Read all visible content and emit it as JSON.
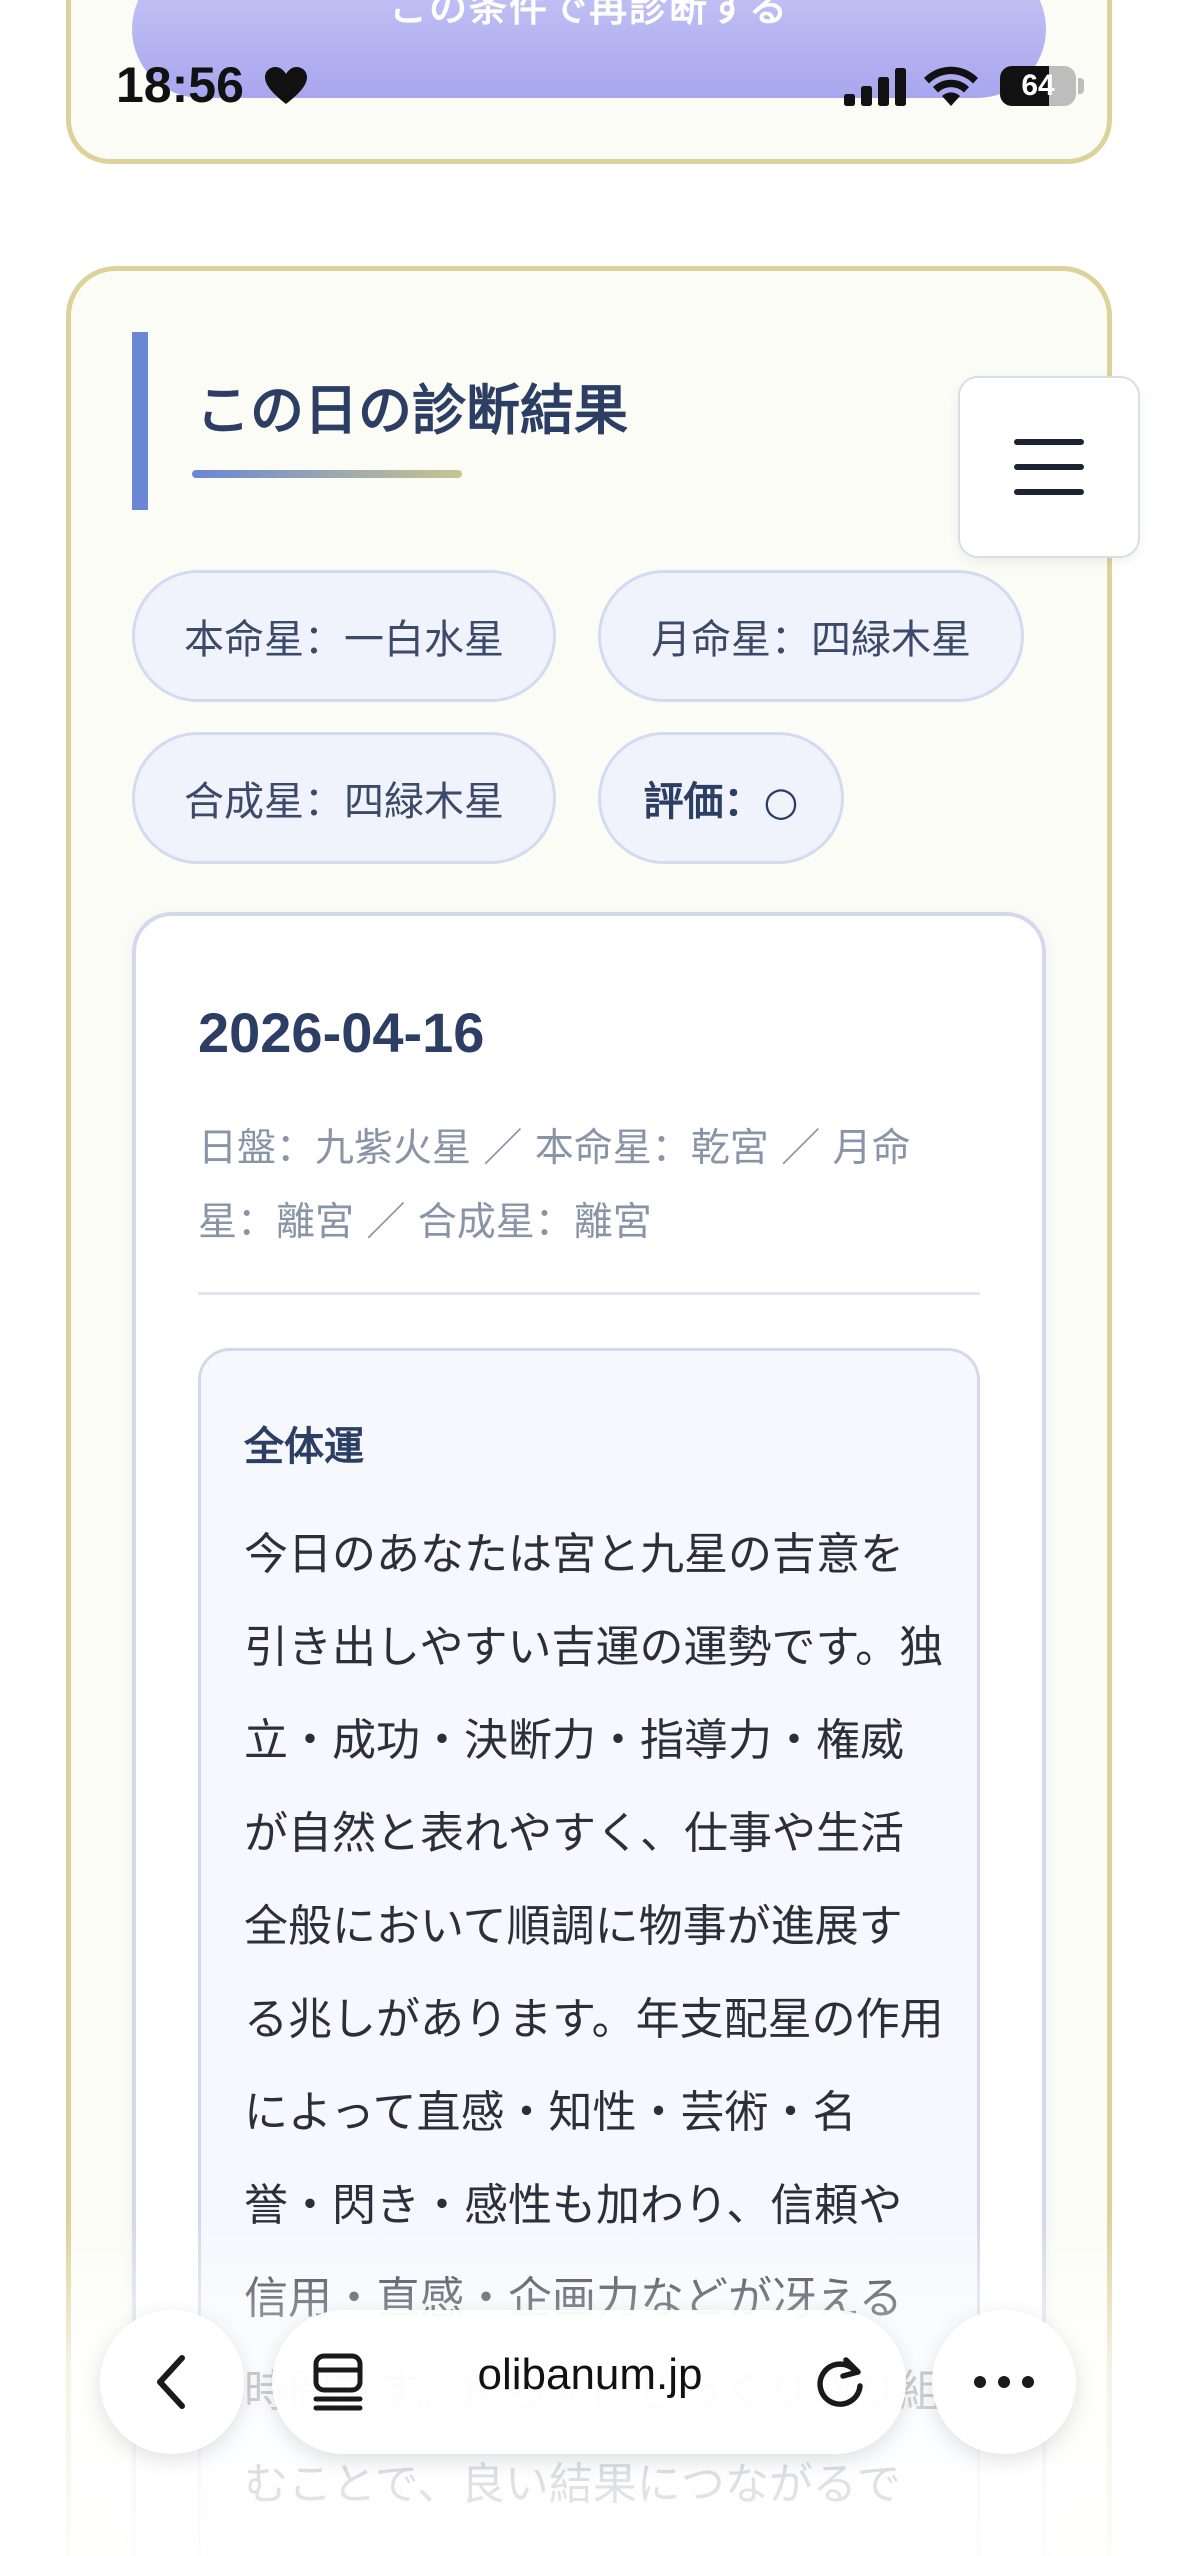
{
  "status_bar": {
    "time": "18:56",
    "battery_level": "64",
    "battery_fraction": 0.64
  },
  "previous_card": {
    "rediagnose_label": "この条件で再診断する"
  },
  "result": {
    "title": "この日の診断結果",
    "chips": {
      "honmei": "本命星：一白水星",
      "getsumei": "月命星：四緑木星",
      "gousei": "合成星：四緑木星",
      "rating": "評価：○"
    },
    "date_card": {
      "date": "2026-04-16",
      "meta": "日盤：九紫火星 ／ 本命星：乾宮 ／ 月命星：離宮 ／ 合成星：離宮",
      "fortune_label": "全体運",
      "fortune_text": "今日のあなたは宮と九星の吉意を引き出しやすい吉運の運勢です。独立・成功・決断力・指導力・権威が自然と表れやすく、仕事や生活全般において順調に物事が進展する兆しがあります。年支配星の作用によって直感・知性・芸術・名誉・閃き・感性も加わり、信頼や信用・直感・企画力などが冴える時間です。焦らずにじっくり取り組むことで、良い結果につながるで"
    }
  },
  "browser": {
    "url": "olibanum.jp"
  },
  "icons": {
    "status": [
      "heart-icon",
      "signal-icon",
      "wifi-icon",
      "battery-icon"
    ],
    "toolbar": [
      "back-icon",
      "tabs-icon",
      "reload-icon",
      "more-icon"
    ],
    "menu": "hamburger-icon"
  },
  "colors": {
    "card_border": "#ddd29a",
    "accent": "#6a86d4",
    "chip_bg": "#f0f3fc",
    "title_text": "#2c3e64",
    "button_gradient_top": "#c9c8f6"
  }
}
